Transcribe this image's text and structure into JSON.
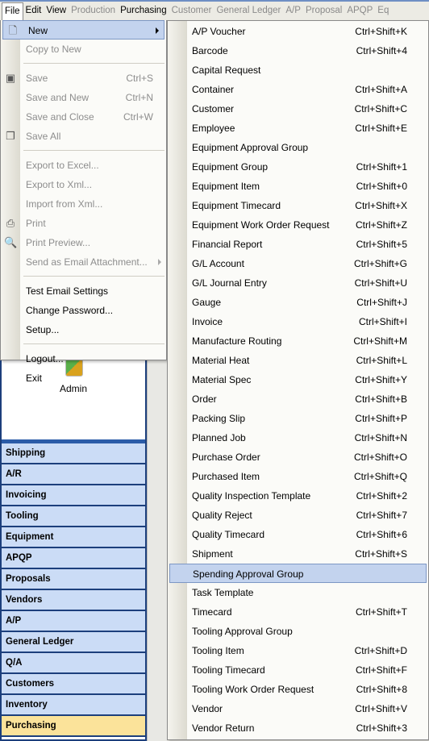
{
  "menubar": [
    "File",
    "Edit",
    "View",
    "Production",
    "Purchasing",
    "Customer",
    "General Ledger",
    "A/P",
    "Proposal",
    "APQP",
    "Eq"
  ],
  "file_menu": {
    "new": "New",
    "copy_to_new": "Copy to New",
    "save": {
      "label": "Save",
      "shortcut": "Ctrl+S"
    },
    "save_new": {
      "label": "Save and New",
      "shortcut": "Ctrl+N"
    },
    "save_close": {
      "label": "Save and Close",
      "shortcut": "Ctrl+W"
    },
    "save_all": "Save All",
    "export_excel": "Export to Excel...",
    "export_xml": "Export to Xml...",
    "import_xml": "Import from Xml...",
    "print": "Print",
    "print_preview": "Print Preview...",
    "send_email": "Send as Email Attachment...",
    "test_email": "Test Email Settings",
    "change_password": "Change Password...",
    "setup": "Setup...",
    "logout": "Logout...",
    "exit": "Exit"
  },
  "new_submenu": [
    {
      "label": "A/P Voucher",
      "shortcut": "Ctrl+Shift+K"
    },
    {
      "label": "Barcode",
      "shortcut": "Ctrl+Shift+4"
    },
    {
      "label": "Capital Request",
      "shortcut": ""
    },
    {
      "label": "Container",
      "shortcut": "Ctrl+Shift+A"
    },
    {
      "label": "Customer",
      "shortcut": "Ctrl+Shift+C"
    },
    {
      "label": "Employee",
      "shortcut": "Ctrl+Shift+E"
    },
    {
      "label": "Equipment Approval Group",
      "shortcut": ""
    },
    {
      "label": "Equipment Group",
      "shortcut": "Ctrl+Shift+1"
    },
    {
      "label": "Equipment Item",
      "shortcut": "Ctrl+Shift+0"
    },
    {
      "label": "Equipment Timecard",
      "shortcut": "Ctrl+Shift+X"
    },
    {
      "label": "Equipment Work Order Request",
      "shortcut": "Ctrl+Shift+Z"
    },
    {
      "label": "Financial Report",
      "shortcut": "Ctrl+Shift+5"
    },
    {
      "label": "G/L Account",
      "shortcut": "Ctrl+Shift+G"
    },
    {
      "label": "G/L Journal Entry",
      "shortcut": "Ctrl+Shift+U"
    },
    {
      "label": "Gauge",
      "shortcut": "Ctrl+Shift+J"
    },
    {
      "label": "Invoice",
      "shortcut": "Ctrl+Shift+I"
    },
    {
      "label": "Manufacture Routing",
      "shortcut": "Ctrl+Shift+M"
    },
    {
      "label": "Material Heat",
      "shortcut": "Ctrl+Shift+L"
    },
    {
      "label": "Material Spec",
      "shortcut": "Ctrl+Shift+Y"
    },
    {
      "label": "Order",
      "shortcut": "Ctrl+Shift+B"
    },
    {
      "label": "Packing Slip",
      "shortcut": "Ctrl+Shift+P"
    },
    {
      "label": "Planned Job",
      "shortcut": "Ctrl+Shift+N"
    },
    {
      "label": "Purchase Order",
      "shortcut": "Ctrl+Shift+O"
    },
    {
      "label": "Purchased Item",
      "shortcut": "Ctrl+Shift+Q"
    },
    {
      "label": "Quality Inspection Template",
      "shortcut": "Ctrl+Shift+2"
    },
    {
      "label": "Quality Reject",
      "shortcut": "Ctrl+Shift+7"
    },
    {
      "label": "Quality Timecard",
      "shortcut": "Ctrl+Shift+6"
    },
    {
      "label": "Shipment",
      "shortcut": "Ctrl+Shift+S"
    },
    {
      "label": "Spending Approval Group",
      "shortcut": ""
    },
    {
      "label": "Task Template",
      "shortcut": ""
    },
    {
      "label": "Timecard",
      "shortcut": "Ctrl+Shift+T"
    },
    {
      "label": "Tooling Approval Group",
      "shortcut": ""
    },
    {
      "label": "Tooling Item",
      "shortcut": "Ctrl+Shift+D"
    },
    {
      "label": "Tooling Timecard",
      "shortcut": "Ctrl+Shift+F"
    },
    {
      "label": "Tooling Work Order Request",
      "shortcut": "Ctrl+Shift+8"
    },
    {
      "label": "Vendor",
      "shortcut": "Ctrl+Shift+V"
    },
    {
      "label": "Vendor Return",
      "shortcut": "Ctrl+Shift+3"
    }
  ],
  "highlighted_submenu_item": "Spending Approval Group",
  "sidebar": {
    "admin_label": "Admin",
    "items": [
      "Shipping",
      "A/R",
      "Invoicing",
      "Tooling",
      "Equipment",
      "APQP",
      "Proposals",
      "Vendors",
      "A/P",
      "General Ledger",
      "Q/A",
      "Customers",
      "Inventory",
      "Purchasing"
    ],
    "selected": "Purchasing"
  }
}
